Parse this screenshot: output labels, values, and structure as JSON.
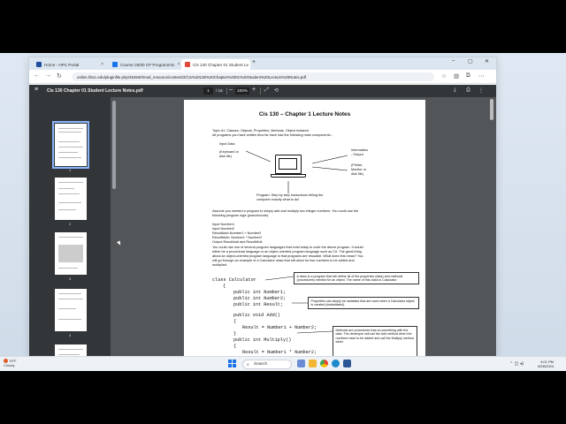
{
  "tabs": [
    {
      "label": "Home - HPC Portal",
      "color": "#1a4f9c"
    },
    {
      "label": "Course 26/00 CP Programmin",
      "color": "#1a73e8"
    },
    {
      "label": "Cis 130 Chapter 01 Student Le",
      "color": "#e0463a"
    }
  ],
  "address": {
    "url": "online.hbcc.edu/pluginfile.php/454940/mod_resource/content/2/Cis%20130%20Chapter%2001%20Student%20Lecture%20Notes.pdf"
  },
  "pdf": {
    "filename": "Cis 130 Chapter 01 Student Lecture Notes.pdf",
    "page_current": "1",
    "page_total": "/ 16",
    "zoom": "100%",
    "thumb_numbers": [
      "1",
      "2",
      "3",
      "4",
      "5"
    ]
  },
  "page": {
    "title": "Cis 130 – Chapter 1 Lecture Notes",
    "topic_line": "Topic #1: Classes, Objects, Properties, Methods, Object Instance",
    "intro_line": "All programs you have written thus far have had the following main components…",
    "diagram": {
      "input_data": "Input Data",
      "keyboard_1": "(Keyboard or",
      "keyboard_2": "disk file)",
      "info_1": "Information",
      "info_2": "- Output",
      "printer_1": "(Printer,",
      "printer_2": "Monitor or",
      "printer_3": "disk file)",
      "program_1": "Program: Step by step instructions telling the",
      "program_2": "computer exactly what to do!"
    },
    "assume_1": "Assume you needed a program to simply add and multiply two integer numbers. You could use the",
    "assume_2": "following program logic (pseudocode):",
    "pseudo": [
      "Input Number1",
      "Input Number2",
      "ResultAdd=Number1 + Number2",
      "ResultMult= Number1 * Number2",
      "Output ResultAdd and ResultMult"
    ],
    "para": [
      "You could use one of several program languages that exist today to code the above program. It would",
      "either be a procedural language or an object oriented program language such as C#. The great thing",
      "about an object-oriented program language is that programs are reusable. What does this mean? You",
      "will go through an example of a Calculator class that will allow for two numbers to be added and",
      "multiplied."
    ],
    "code": [
      "class Calculator",
      "{",
      "public int Number1;",
      "public int Number2;",
      "public int Result;",
      "public void Add()",
      "{",
      "Result = Number1 + Number2;",
      "}",
      "public int Multiply()",
      "{",
      "Result = Number1 * Number2;"
    ],
    "callout_class": "A class is a program that will define all of the properties (data) and methods (procedures) needed for an object. The name of this class is Calculator.",
    "callout_props": "Properties can simply be variables that are used when a Calculator object is created (instantiated).",
    "callout_methods": "Methods are procedures that do something with the data. The developer will call the Add method when the numbers have to be added and call the Multiply method when"
  },
  "taskbar": {
    "weather_temp": "78°F",
    "weather_desc": "Cloudy",
    "search_placeholder": "Search",
    "time": "4:01 PM",
    "date": "8/28/2024"
  }
}
